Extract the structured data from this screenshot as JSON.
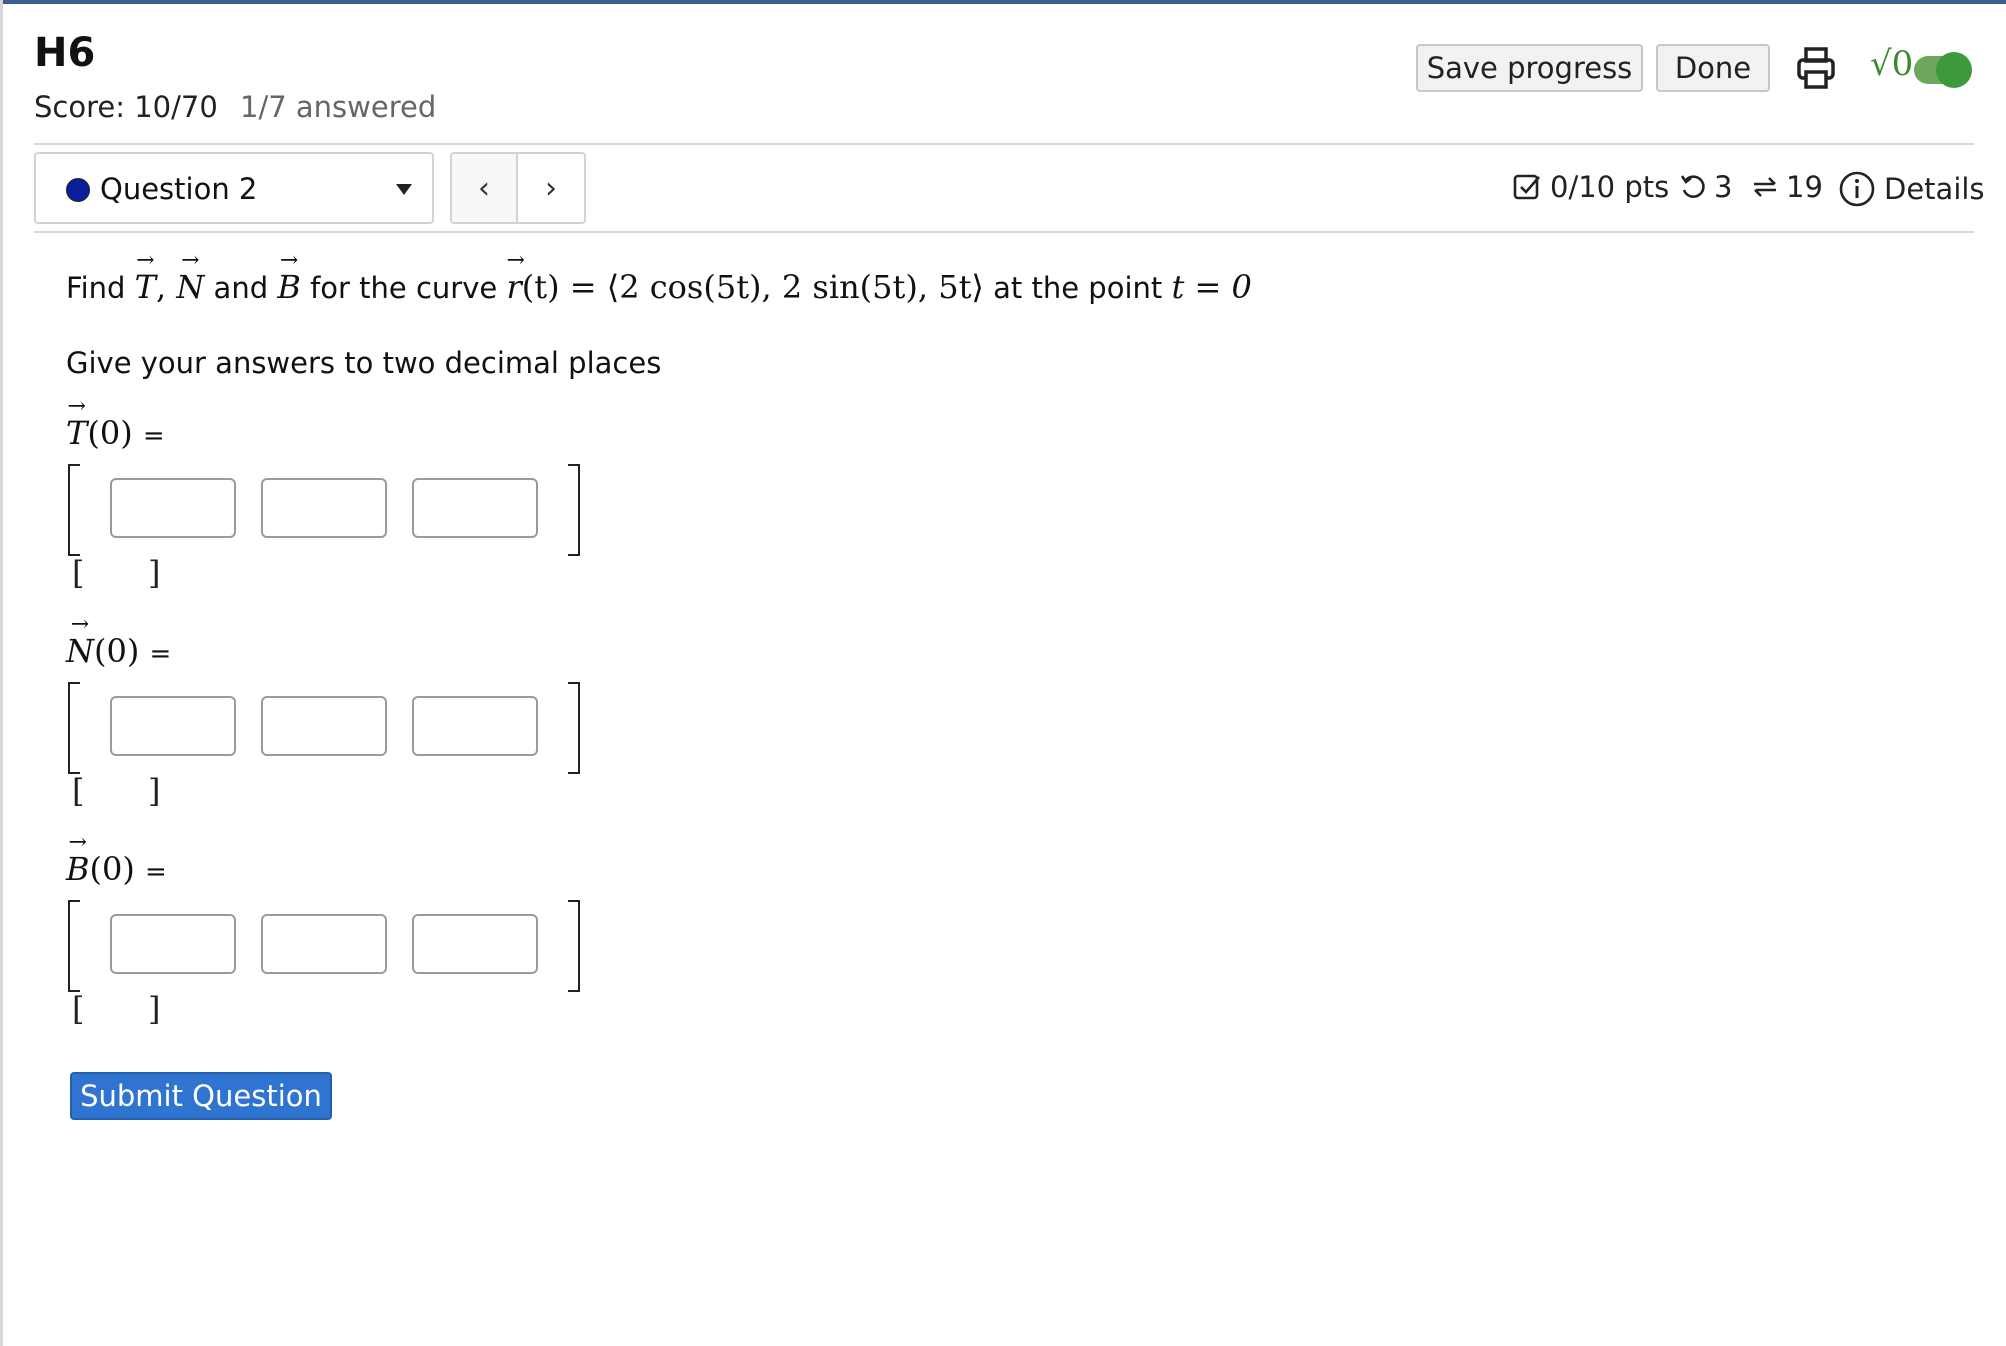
{
  "header": {
    "title": "H6",
    "score": "Score: 10/70",
    "answered": "1/7 answered",
    "save_label": "Save progress",
    "done_label": "Done"
  },
  "question_nav": {
    "selected": "Question 2",
    "prev": "‹",
    "next": "›"
  },
  "meta": {
    "points": "0/10 pts",
    "retries": "3",
    "attempts": "19",
    "details": "Details"
  },
  "question": {
    "prompt_find": "Find",
    "prompt_and": "and",
    "prompt_for_curve": "for the curve",
    "prompt_at_point": "at the point",
    "curve_expr": "(t) = ⟨2 cos(5t), 2 sin(5t), 5t⟩",
    "point_expr": "t = 0",
    "instruction": "Give your answers to two decimal places",
    "vectors": [
      {
        "symbol": "T",
        "arg": "(0)",
        "eq": "="
      },
      {
        "symbol": "N",
        "arg": "(0)",
        "eq": "="
      },
      {
        "symbol": "B",
        "arg": "(0)",
        "eq": "="
      }
    ],
    "preview_left": "[",
    "preview_right": "]"
  },
  "submit_label": "Submit Question",
  "colors": {
    "accent_bar": "#3b5d8f",
    "submit_bg": "#2f74d0",
    "toggle_on": "#3d9a3a",
    "status_dot": "#0b1e9c"
  },
  "icons": [
    "print-icon",
    "sqrt-icon",
    "toggle-switch",
    "checkbox-icon",
    "retry-icon",
    "attempts-icon",
    "info-icon",
    "caret-down-icon"
  ]
}
